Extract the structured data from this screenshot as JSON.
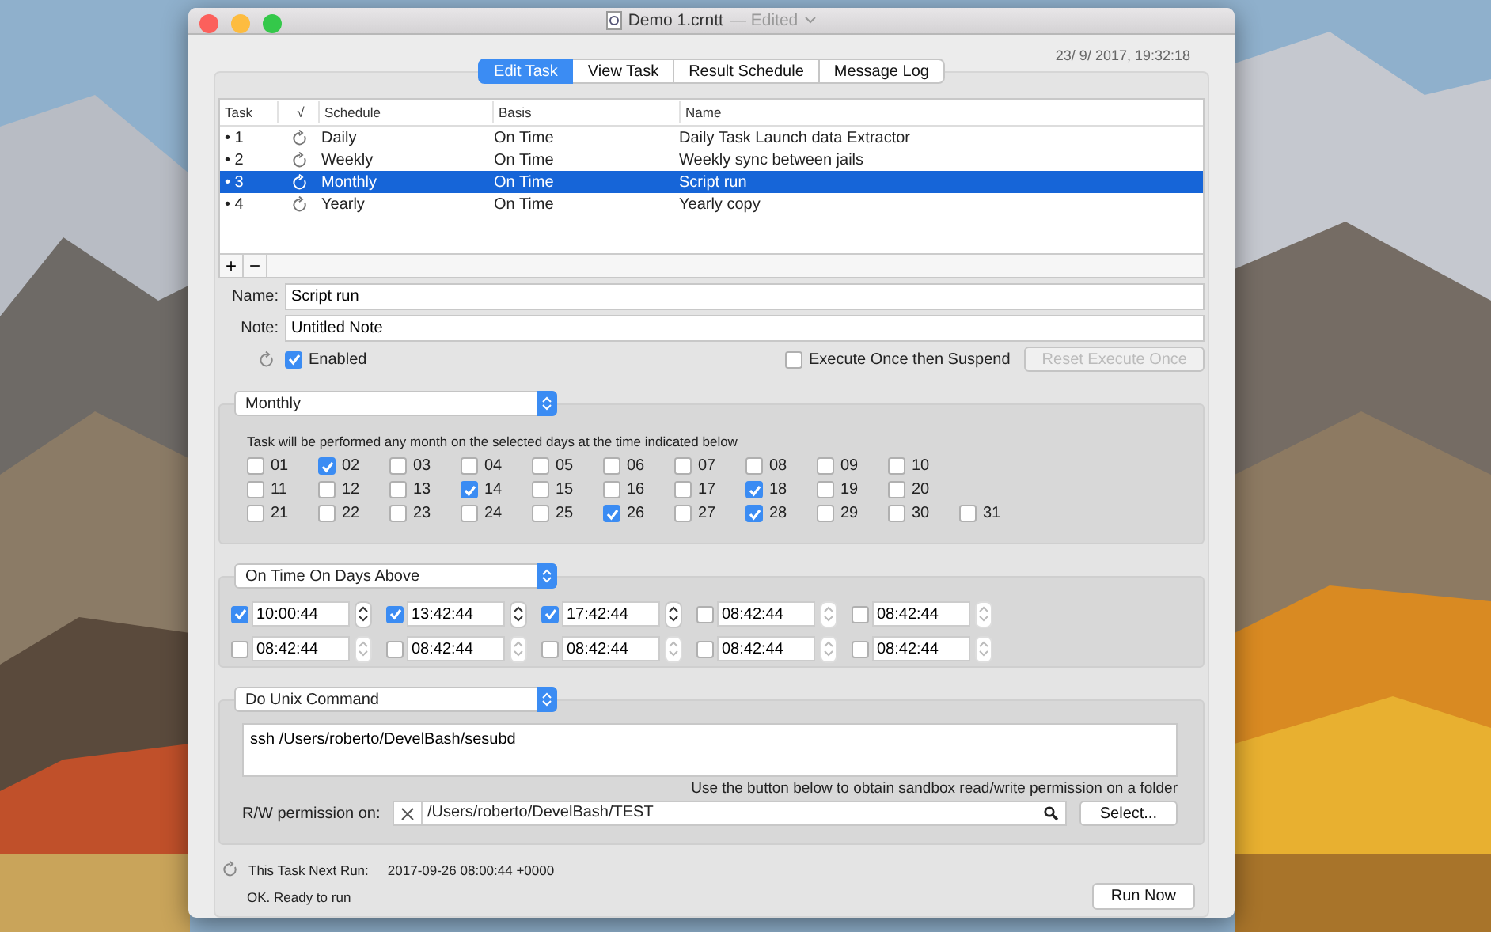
{
  "window": {
    "title": "Demo 1.crntt",
    "subtitle": "— Edited"
  },
  "timestamp": "23/ 9/ 2017, 19:32:18",
  "tabs": [
    {
      "label": "Edit Task",
      "selected": true
    },
    {
      "label": "View Task",
      "selected": false
    },
    {
      "label": "Result Schedule",
      "selected": false
    },
    {
      "label": "Message Log",
      "selected": false
    }
  ],
  "table": {
    "columns": [
      "Task",
      "√",
      "Schedule",
      "Basis",
      "Name"
    ],
    "rows": [
      {
        "task": "• 1",
        "schedule": "Daily",
        "basis": "On Time",
        "name": "Daily Task Launch data Extractor",
        "selected": false
      },
      {
        "task": "• 2",
        "schedule": "Weekly",
        "basis": "On Time",
        "name": "Weekly sync between jails",
        "selected": false
      },
      {
        "task": "• 3",
        "schedule": "Monthly",
        "basis": "On Time",
        "name": "Script run",
        "selected": true
      },
      {
        "task": "• 4",
        "schedule": "Yearly",
        "basis": "On Time",
        "name": "Yearly copy",
        "selected": false
      }
    ],
    "buttons": [
      "+",
      "−"
    ]
  },
  "form": {
    "name": {
      "label": "Name:",
      "value": "Script run"
    },
    "note": {
      "label": "Note:",
      "value": "Untitled Note"
    },
    "enabled": {
      "label": "Enabled",
      "checked": true
    },
    "execute_once": {
      "label": "Execute Once then Suspend",
      "checked": false
    },
    "reset_button": {
      "label": "Reset Execute Once",
      "disabled": true
    }
  },
  "schedule": {
    "popup": "Monthly",
    "description": "Task will be performed any month on the selected days at the time indicated below",
    "day_rows": [
      [
        {
          "label": "01",
          "checked": false
        },
        {
          "label": "02",
          "checked": true
        },
        {
          "label": "03",
          "checked": false
        },
        {
          "label": "04",
          "checked": false
        },
        {
          "label": "05",
          "checked": false
        },
        {
          "label": "06",
          "checked": false
        },
        {
          "label": "07",
          "checked": false
        },
        {
          "label": "08",
          "checked": false
        },
        {
          "label": "09",
          "checked": false
        },
        {
          "label": "10",
          "checked": false
        }
      ],
      [
        {
          "label": "11",
          "checked": false
        },
        {
          "label": "12",
          "checked": false
        },
        {
          "label": "13",
          "checked": false
        },
        {
          "label": "14",
          "checked": true
        },
        {
          "label": "15",
          "checked": false
        },
        {
          "label": "16",
          "checked": false
        },
        {
          "label": "17",
          "checked": false
        },
        {
          "label": "18",
          "checked": true
        },
        {
          "label": "19",
          "checked": false
        },
        {
          "label": "20",
          "checked": false
        }
      ],
      [
        {
          "label": "21",
          "checked": false
        },
        {
          "label": "22",
          "checked": false
        },
        {
          "label": "23",
          "checked": false
        },
        {
          "label": "24",
          "checked": false
        },
        {
          "label": "25",
          "checked": false
        },
        {
          "label": "26",
          "checked": true
        },
        {
          "label": "27",
          "checked": false
        },
        {
          "label": "28",
          "checked": true
        },
        {
          "label": "29",
          "checked": false
        },
        {
          "label": "30",
          "checked": false
        },
        {
          "label": "31",
          "checked": false
        }
      ]
    ]
  },
  "times": {
    "popup": "On Time On Days Above",
    "slot_rows": [
      [
        {
          "value": "10:00:44",
          "checked": true
        },
        {
          "value": "13:42:44",
          "checked": true
        },
        {
          "value": "17:42:44",
          "checked": true
        },
        {
          "value": "08:42:44",
          "checked": false
        },
        {
          "value": "08:42:44",
          "checked": false
        }
      ],
      [
        {
          "value": "08:42:44",
          "checked": false
        },
        {
          "value": "08:42:44",
          "checked": false
        },
        {
          "value": "08:42:44",
          "checked": false
        },
        {
          "value": "08:42:44",
          "checked": false
        },
        {
          "value": "08:42:44",
          "checked": false
        }
      ]
    ]
  },
  "action": {
    "popup": "Do Unix Command",
    "command": "ssh /Users/roberto/DevelBash/sesubd",
    "hint": "Use the button below to obtain sandbox read/write permission on a folder",
    "permission_label": "R/W permission on:",
    "permission_path": "/Users/roberto/DevelBash/TEST",
    "select_button": "Select..."
  },
  "footer": {
    "next_run_label": "This Task Next Run:",
    "next_run_value": "2017-09-26 08:00:44 +0000",
    "status": "OK. Ready to run",
    "run_button": "Run Now"
  }
}
